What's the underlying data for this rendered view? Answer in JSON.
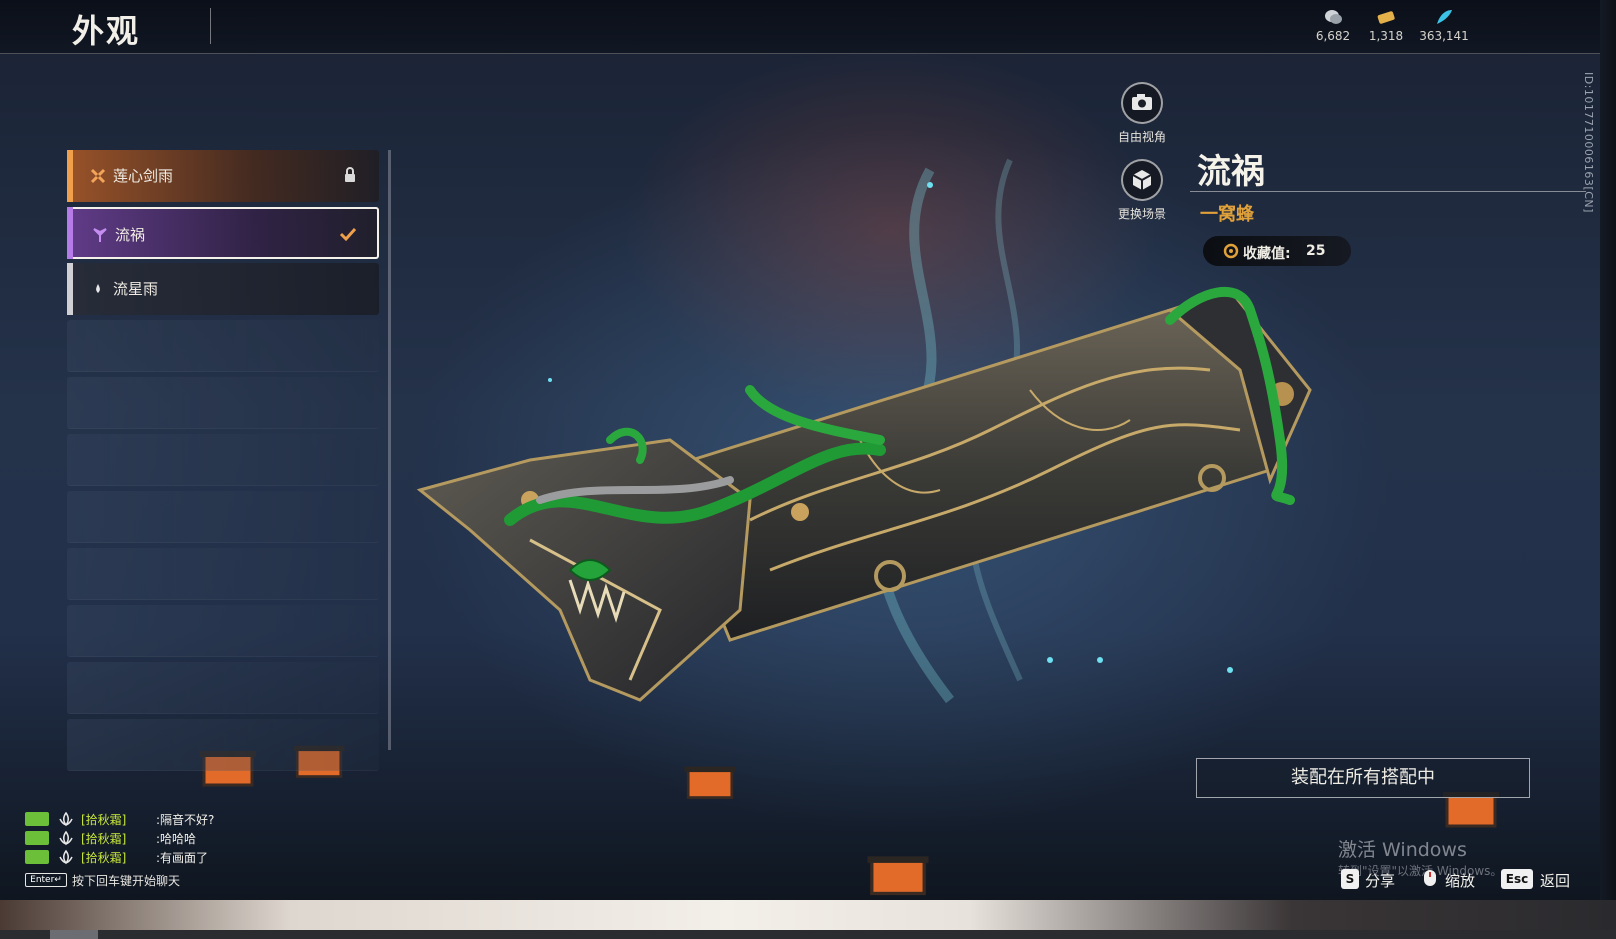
{
  "header": {
    "title": "外观",
    "currencies": [
      {
        "icon": "coin-stack-icon",
        "value": "6,682"
      },
      {
        "icon": "ticket-icon",
        "value": "1,318"
      },
      {
        "icon": "feather-icon",
        "value": "363,141"
      }
    ]
  },
  "side_id": "ID:1017710006163[CN]",
  "list": {
    "items": [
      {
        "label": "莲心剑雨",
        "icon": "lotus-blades-icon",
        "state": "lock-icon"
      },
      {
        "label": "流祸",
        "icon": "triple-petal-icon",
        "state": "checkmark-icon"
      },
      {
        "label": "流星雨",
        "icon": "drop-icon",
        "state": ""
      }
    ]
  },
  "camera": {
    "free_view": "自由视角",
    "change_scene": "更换场景"
  },
  "info": {
    "name": "流祸",
    "series": "一窝蜂",
    "collect_label": "收藏值:",
    "collect_value": "25"
  },
  "equip_all_label": "装配在所有搭配中",
  "chat": {
    "lines": [
      {
        "who": "[拾秋霜]",
        "msg": ":隔音不好?"
      },
      {
        "who": "[拾秋霜]",
        "msg": ":哈哈哈"
      },
      {
        "who": "[拾秋霜]",
        "msg": ":有画面了"
      }
    ],
    "enter_key": "Enter↵",
    "hint": "按下回车键开始聊天"
  },
  "footer": {
    "share_key": "S",
    "share_label": "分享",
    "zoom_label": "缩放",
    "back_key": "Esc",
    "back_label": "返回"
  },
  "watermark": {
    "line1": "激活 Windows",
    "line2": "转到\"设置\"以激活 Windows。"
  },
  "colors": {
    "accent_orange": "#f0a04a",
    "accent_purple": "#b57be8",
    "series_gold": "#e0a13a",
    "chat_name": "#c9e83a",
    "chat_badge": "#6cbf38"
  }
}
